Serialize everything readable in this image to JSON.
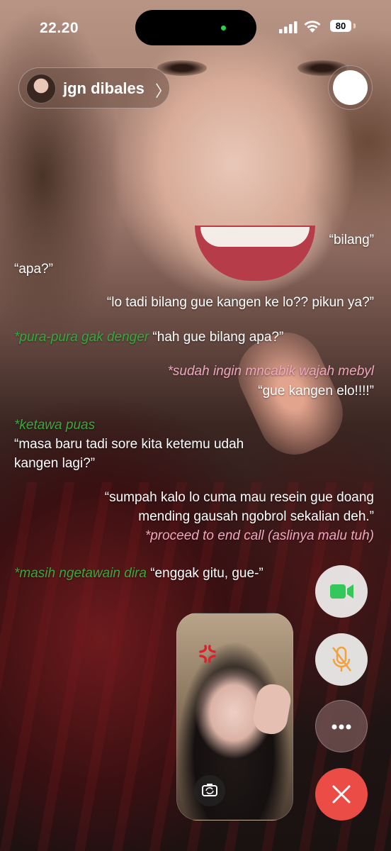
{
  "status_bar": {
    "time": "22.20",
    "battery": "80",
    "signal_icon": "cellular-signal-icon",
    "wifi_icon": "wifi-icon"
  },
  "contact": {
    "name": "jgn dibales",
    "chevron": "〉"
  },
  "chat_lines": [
    {
      "text": "“bilang”"
    },
    {
      "text": "“apa?”"
    },
    {
      "text": "“lo tadi bilang gue kangen ke lo?? pikun ya?”"
    },
    {
      "action": "*pura-pura gak denger",
      "text": "“hah gue bilang apa?”"
    },
    {
      "action": "*sudah ingin mncabik wajah mebyl"
    },
    {
      "text": "“gue kangen elo!!!!”"
    },
    {
      "action": "*ketawa puas"
    },
    {
      "text": "“masa baru tadi sore kita ketemu udah"
    },
    {
      "text": "kangen lagi?”"
    },
    {
      "text": "“sumpah kalo lo cuma mau resein gue doang"
    },
    {
      "text": "mending gausah ngobrol sekalian deh.”"
    },
    {
      "action": "*proceed to end call (aslinya malu tuh)"
    },
    {
      "action": "*masih ngetawain dira",
      "text": "“enggak gitu, gue-”"
    }
  ],
  "controls": {
    "video_icon": "video-camera-icon",
    "mute_icon": "microphone-muted-icon",
    "more_icon": "more-dots-icon",
    "end_icon": "close-icon",
    "flip_icon": "flip-camera-icon",
    "colors": {
      "video_green": "#34c759",
      "mute_orange": "#f0a33c",
      "end_red": "#eb4d46",
      "action_green": "#36a83c",
      "action_pink": "#f0a6bd"
    }
  }
}
